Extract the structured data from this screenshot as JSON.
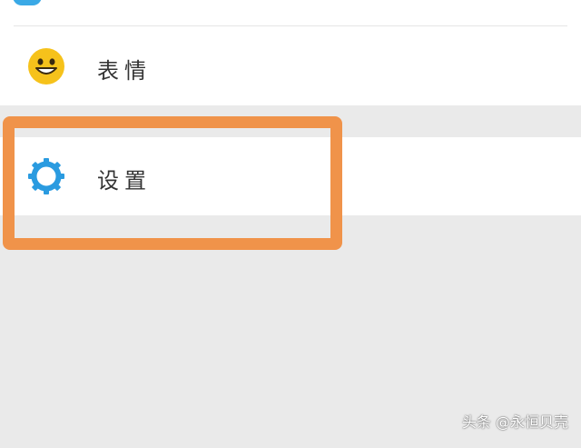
{
  "menu": {
    "items": [
      {
        "label": "表情",
        "icon": "smiley-face-icon",
        "icon_color": "#f6c21b"
      },
      {
        "label": "设置",
        "icon": "gear-icon",
        "icon_color": "#2a9be0"
      }
    ]
  },
  "annotation": {
    "highlight_color": "#f0934a"
  },
  "watermark": {
    "text": "头条 @永恒贝壳"
  }
}
